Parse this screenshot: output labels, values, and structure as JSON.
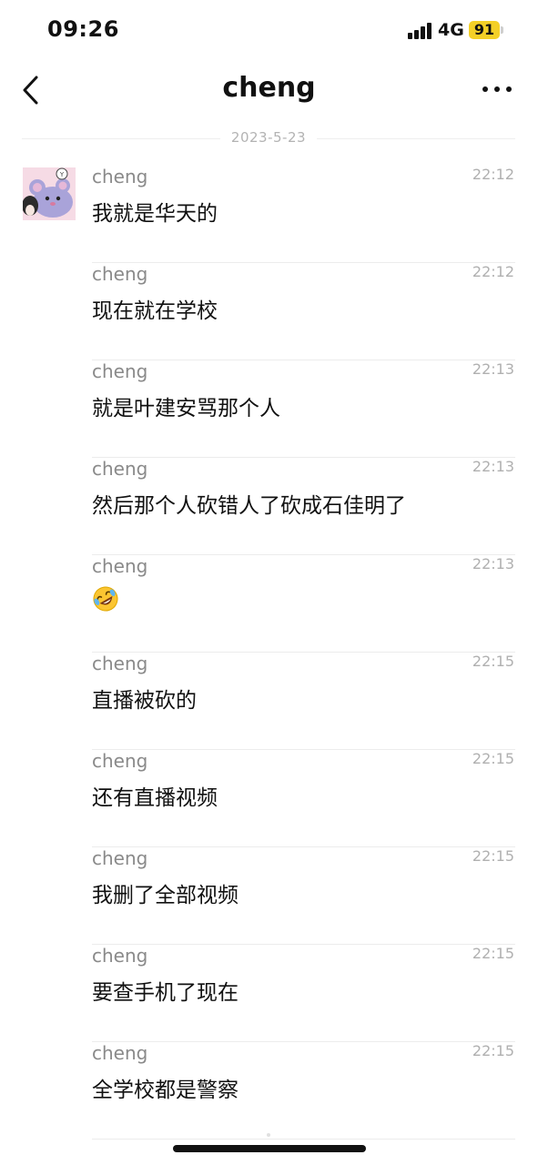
{
  "status_bar": {
    "time": "09:26",
    "network": "4G",
    "battery": "91",
    "battery_color": "#f4d027"
  },
  "nav": {
    "title": "cheng",
    "back_icon": "chevron-left-icon",
    "more_icon": "more-horizontal-icon"
  },
  "date_separator": "2023-5-23",
  "messages": [
    {
      "sender": "cheng",
      "time": "22:12",
      "text": "我就是华天的"
    },
    {
      "sender": "cheng",
      "time": "22:12",
      "text": "现在就在学校"
    },
    {
      "sender": "cheng",
      "time": "22:13",
      "text": "就是叶建安骂那个人"
    },
    {
      "sender": "cheng",
      "time": "22:13",
      "text": "然后那个人砍错人了砍成石佳明了"
    },
    {
      "sender": "cheng",
      "time": "22:13",
      "text": "",
      "emoji": "rolling-on-floor-laughing-emoji"
    },
    {
      "sender": "cheng",
      "time": "22:15",
      "text": "直播被砍的"
    },
    {
      "sender": "cheng",
      "time": "22:15",
      "text": "还有直播视频"
    },
    {
      "sender": "cheng",
      "time": "22:15",
      "text": "我删了全部视频"
    },
    {
      "sender": "cheng",
      "time": "22:15",
      "text": "要查手机了现在"
    },
    {
      "sender": "cheng",
      "time": "22:15",
      "text": "全学校都是警察"
    }
  ]
}
